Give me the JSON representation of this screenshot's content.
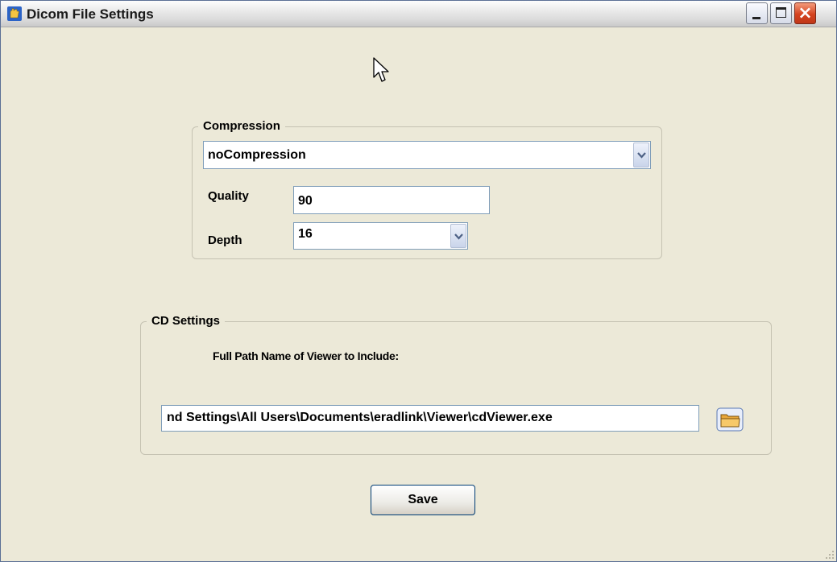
{
  "window": {
    "title": "Dicom File Settings",
    "buttons": {
      "minimize": "minimize",
      "maximize": "maximize",
      "close": "×"
    }
  },
  "compression_group": {
    "legend": "Compression",
    "compression_value": "noCompression",
    "quality_label": "Quality",
    "quality_value": "90",
    "depth_label": "Depth",
    "depth_value": "16"
  },
  "cd_group": {
    "legend": "CD Settings",
    "viewer_label": "Full Path Name of Viewer to Include:",
    "viewer_path": "nd Settings\\All Users\\Documents\\eradlink\\Viewer\\cdViewer.exe"
  },
  "save_label": "Save",
  "icons": [
    "app-icon",
    "minimize-icon",
    "maximize-icon",
    "close-icon",
    "cursor-icon",
    "chevron-down-icon",
    "folder-icon",
    "resize-grip-icon"
  ],
  "colors": {
    "background": "#ece9d8",
    "close_button": "#d5431f",
    "input_border": "#7f9db9"
  }
}
